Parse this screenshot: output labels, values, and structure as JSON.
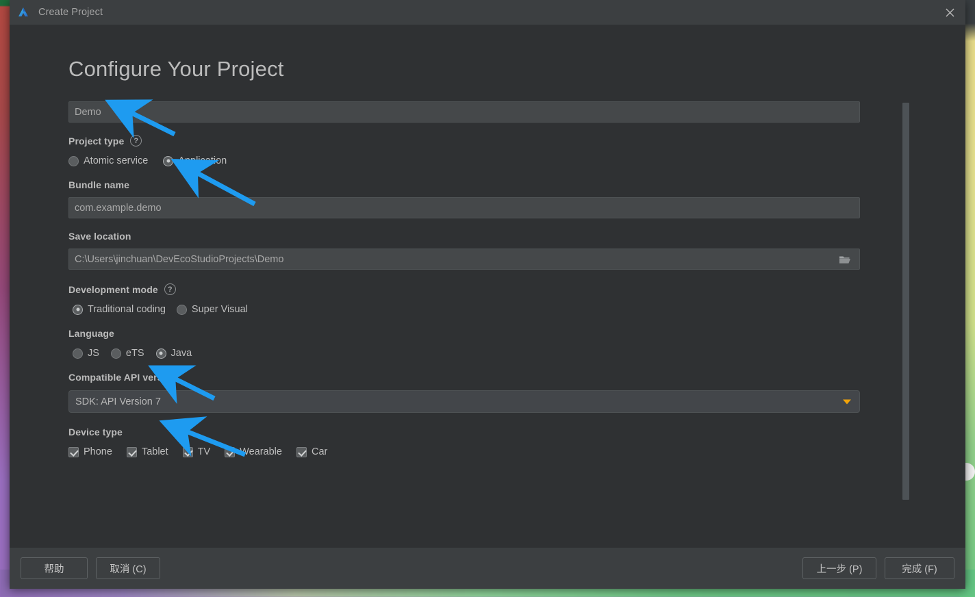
{
  "window": {
    "title": "Create Project",
    "logo_icon": "deveco-studio-logo-icon",
    "close_icon": "close-icon"
  },
  "page": {
    "title": "Configure Your Project"
  },
  "fields": {
    "project_name": {
      "value": "Demo"
    },
    "project_type": {
      "label": "Project type",
      "help_icon": "help-circle-icon",
      "help_glyph": "?",
      "options": [
        {
          "label": "Atomic service",
          "selected": false
        },
        {
          "label": "Application",
          "selected": true
        }
      ]
    },
    "bundle_name": {
      "label": "Bundle name",
      "value": "com.example.demo"
    },
    "save_location": {
      "label": "Save location",
      "value": "C:\\Users\\jinchuan\\DevEcoStudioProjects\\Demo",
      "browse_icon": "folder-icon"
    },
    "development_mode": {
      "label": "Development mode",
      "help_icon": "help-circle-icon",
      "help_glyph": "?",
      "options": [
        {
          "label": "Traditional coding",
          "selected": true
        },
        {
          "label": "Super Visual",
          "selected": false
        }
      ]
    },
    "language": {
      "label": "Language",
      "options": [
        {
          "label": "JS",
          "selected": false
        },
        {
          "label": "eTS",
          "selected": false
        },
        {
          "label": "Java",
          "selected": true
        }
      ]
    },
    "compatible_api_version": {
      "label": "Compatible API version",
      "value": "SDK: API Version 7",
      "arrow_icon": "chevron-down-icon"
    },
    "device_type": {
      "label": "Device type",
      "options": [
        {
          "label": "Phone",
          "checked": true
        },
        {
          "label": "Tablet",
          "checked": true
        },
        {
          "label": "TV",
          "checked": true
        },
        {
          "label": "Wearable",
          "checked": true
        },
        {
          "label": "Car",
          "checked": true
        }
      ]
    }
  },
  "footer": {
    "help": "帮助",
    "cancel": "取消 (C)",
    "previous": "上一步 (P)",
    "finish": "完成 (F)"
  },
  "annotations": {
    "color": "#1e9bf0",
    "arrows": [
      {
        "target": "project-name-input"
      },
      {
        "target": "application-radio"
      },
      {
        "target": "java-radio"
      },
      {
        "target": "api-version-combo"
      }
    ]
  },
  "colors": {
    "dialog_bg": "#3c3f41",
    "body_bg": "#2f3133",
    "input_bg": "#45484a",
    "accent_arrow": "#f0a30a",
    "text": "#bebebe"
  }
}
